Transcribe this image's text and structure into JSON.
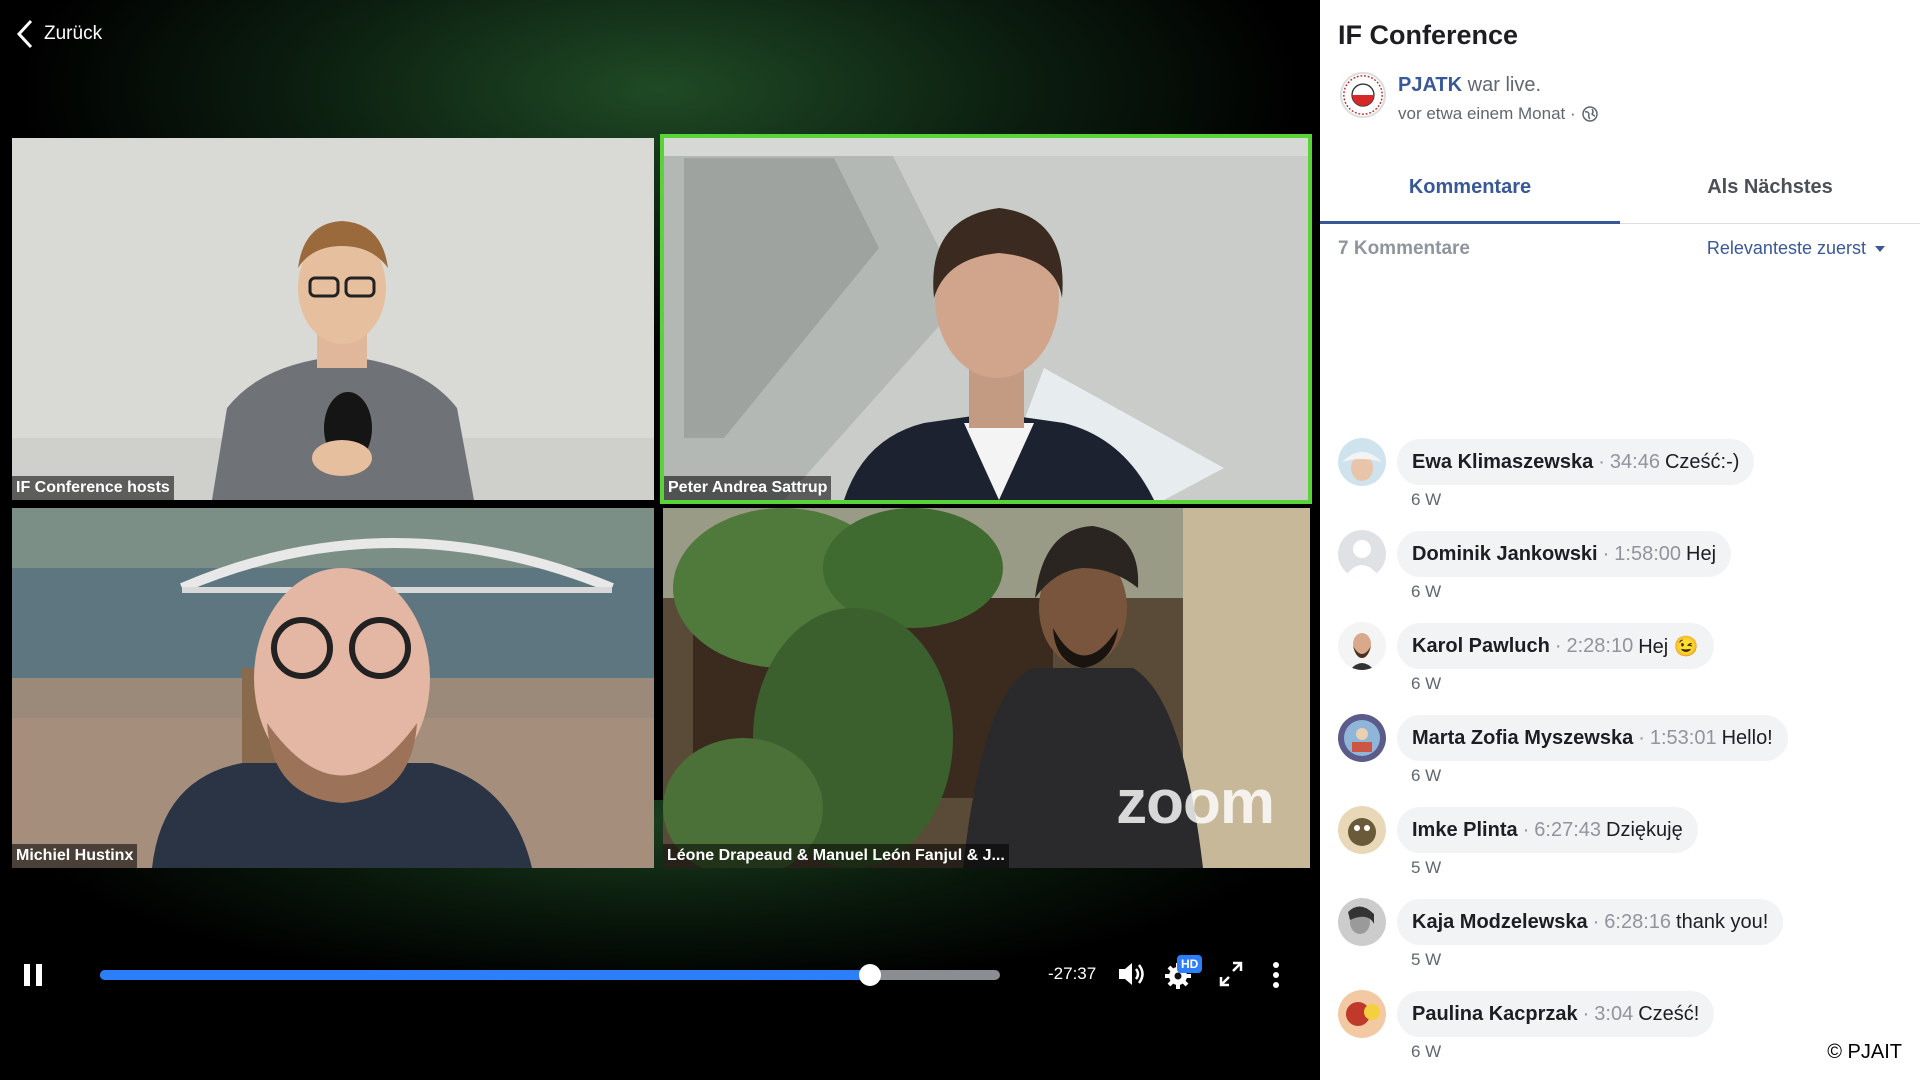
{
  "video": {
    "back_label": "Zurück",
    "participants": [
      {
        "name": "IF Conference hosts",
        "active": false
      },
      {
        "name": "Peter Andrea Sattrup",
        "active": true
      },
      {
        "name": "Michiel Hustinx",
        "active": false
      },
      {
        "name": "Léone Drapeaud & Manuel León Fanjul & J...",
        "active": false
      }
    ],
    "watermark": "zoom",
    "progress_fraction": 0.855,
    "time_remaining": "-27:37",
    "quality_badge": "HD",
    "accent_color": "#2d7ff9",
    "active_speaker_color": "#58d338"
  },
  "post": {
    "title": "IF Conference",
    "page_name": "PJATK",
    "status_text": "war live.",
    "posted": "vor etwa einem Monat ·",
    "privacy_icon": "globe-icon"
  },
  "tabs": {
    "comments_label": "Kommentare",
    "next_label": "Als Nächstes"
  },
  "comments_header": {
    "count_label": "7 Kommentare",
    "sort_label": "Relevanteste zuerst"
  },
  "comments": [
    {
      "author": "Ewa Klimaszewska",
      "timestamp": "34:46",
      "text": "Cześć:-)",
      "age": "6 W"
    },
    {
      "author": "Dominik Jankowski",
      "timestamp": "1:58:00",
      "text": "Hej",
      "age": "6 W"
    },
    {
      "author": "Karol Pawluch",
      "timestamp": "2:28:10",
      "text": "Hej 😉",
      "age": "6 W"
    },
    {
      "author": "Marta Zofia Myszewska",
      "timestamp": "1:53:01",
      "text": "Hello!",
      "age": "6 W"
    },
    {
      "author": "Imke Plinta",
      "timestamp": "6:27:43",
      "text": "Dziękuję",
      "age": "5 W"
    },
    {
      "author": "Kaja Modzelewska",
      "timestamp": "6:28:16",
      "text": "thank you!",
      "age": "5 W"
    },
    {
      "author": "Paulina Kacprzak",
      "timestamp": "3:04",
      "text": "Cześć!",
      "age": "6 W"
    }
  ],
  "copyright": "© PJAIT"
}
